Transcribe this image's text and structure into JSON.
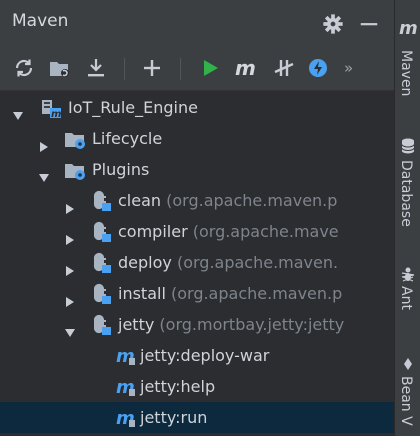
{
  "panel": {
    "title": "Maven"
  },
  "toolbar": {
    "overflow": "»"
  },
  "tree": {
    "project": "IoT_Rule_Engine",
    "lifecycle": "Lifecycle",
    "plugins": "Plugins",
    "plugin_items": [
      {
        "name": "clean",
        "detail": "(org.apache.maven.p"
      },
      {
        "name": "compiler",
        "detail": "(org.apache.mave"
      },
      {
        "name": "deploy",
        "detail": "(org.apache.maven."
      },
      {
        "name": "install",
        "detail": "(org.apache.maven.p"
      },
      {
        "name": "jetty",
        "detail": "(org.mortbay.jetty:jetty"
      }
    ],
    "goals": [
      {
        "name": "jetty:deploy-war"
      },
      {
        "name": "jetty:help"
      },
      {
        "name": "jetty:run"
      }
    ]
  },
  "right_bar": {
    "m_label": "m",
    "tabs": [
      "Maven",
      "Database",
      "Ant",
      "Bean V"
    ]
  },
  "colors": {
    "accent": "#4aa1f2",
    "run_green": "#2fb34a",
    "selected_row": "#0d293e"
  }
}
